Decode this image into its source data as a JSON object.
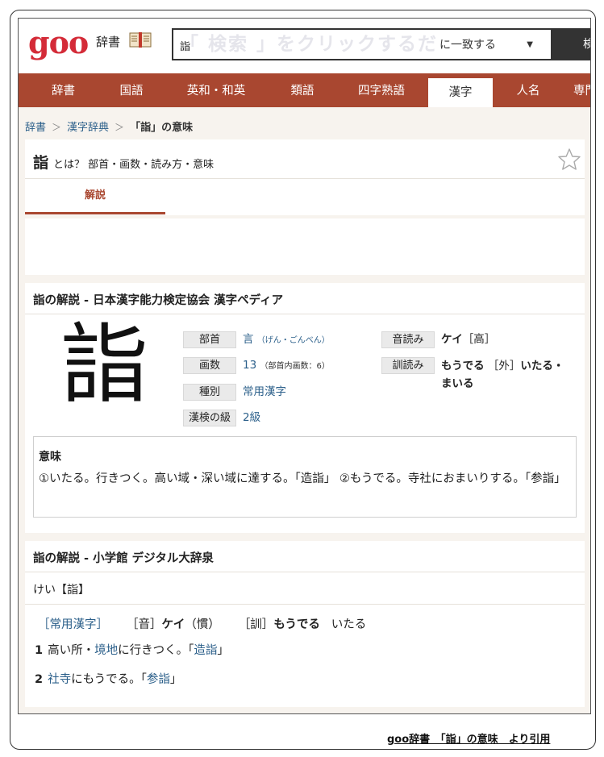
{
  "header": {
    "logo": "goo",
    "dictionary_label": "辞書",
    "search_value": "詣",
    "ghost_text": "「 検索 」をクリックするだけ",
    "match_mode": "に一致する",
    "search_button": "検索"
  },
  "nav": {
    "tabs": [
      "辞書",
      "国語",
      "英和・和英",
      "類語",
      "四字熟語",
      "漢字",
      "人名",
      "専門用語"
    ],
    "active": "漢字"
  },
  "breadcrumb": {
    "items": [
      "辞書",
      "漢字辞典"
    ],
    "current": "「詣」の意味"
  },
  "title": {
    "kanji": "詣",
    "subtitle": "とは？ 部首・画数・読み方・意味",
    "tab_label": "解説"
  },
  "kanjipedia": {
    "section_title": "詣の解説 - 日本漢字能力検定協会 漢字ペディア",
    "kanji": "詣",
    "labels": {
      "radical": "部首",
      "strokes": "画数",
      "type": "種別",
      "kanken": "漢検の級",
      "on": "音読み",
      "kun": "訓読み"
    },
    "radical": "言",
    "radical_reading": "（げん・ごんべん）",
    "strokes": "13",
    "strokes_note": "（部首内画数：6）",
    "type": "常用漢字",
    "kanken": "2級",
    "on_reading": "ケイ",
    "on_note": "［高］",
    "kun_reading_1": "もうでる",
    "kun_note": "［外］",
    "kun_reading_2": "いたる・",
    "kun_reading_3": "まいる",
    "meaning_heading": "意味",
    "meaning_text": "①いたる。行きつく。高い域・深い域に達する。「造詣」 ②もうでる。寺社におまいりする。「参詣」"
  },
  "shogakukan": {
    "section_title": "詣の解説 - 小学館 デジタル大辞泉",
    "reading": "けい【詣】",
    "info": {
      "jouyou": "［常用漢字］",
      "on_label": "［音］",
      "on": "ケイ",
      "on_note": "（慣）",
      "kun_label": "［訓］",
      "kun": "もうでる",
      "kun_extra": "いたる"
    },
    "definitions": [
      {
        "num": "1",
        "pre": "高い所・",
        "link1": "境地",
        "mid": "に行きつく。「",
        "link2": "造詣",
        "post": "」"
      },
      {
        "num": "2",
        "pre": "",
        "link1": "社寺",
        "mid": "にもうでる。「",
        "link2": "参詣",
        "post": "」"
      }
    ]
  },
  "citation": "goo辞書　「詣」の意味　より引用",
  "colors": {
    "brand_red": "#d42b38",
    "nav_bg": "#a94730",
    "link": "#2b5f8a",
    "page_bg": "#f7f3ee"
  }
}
